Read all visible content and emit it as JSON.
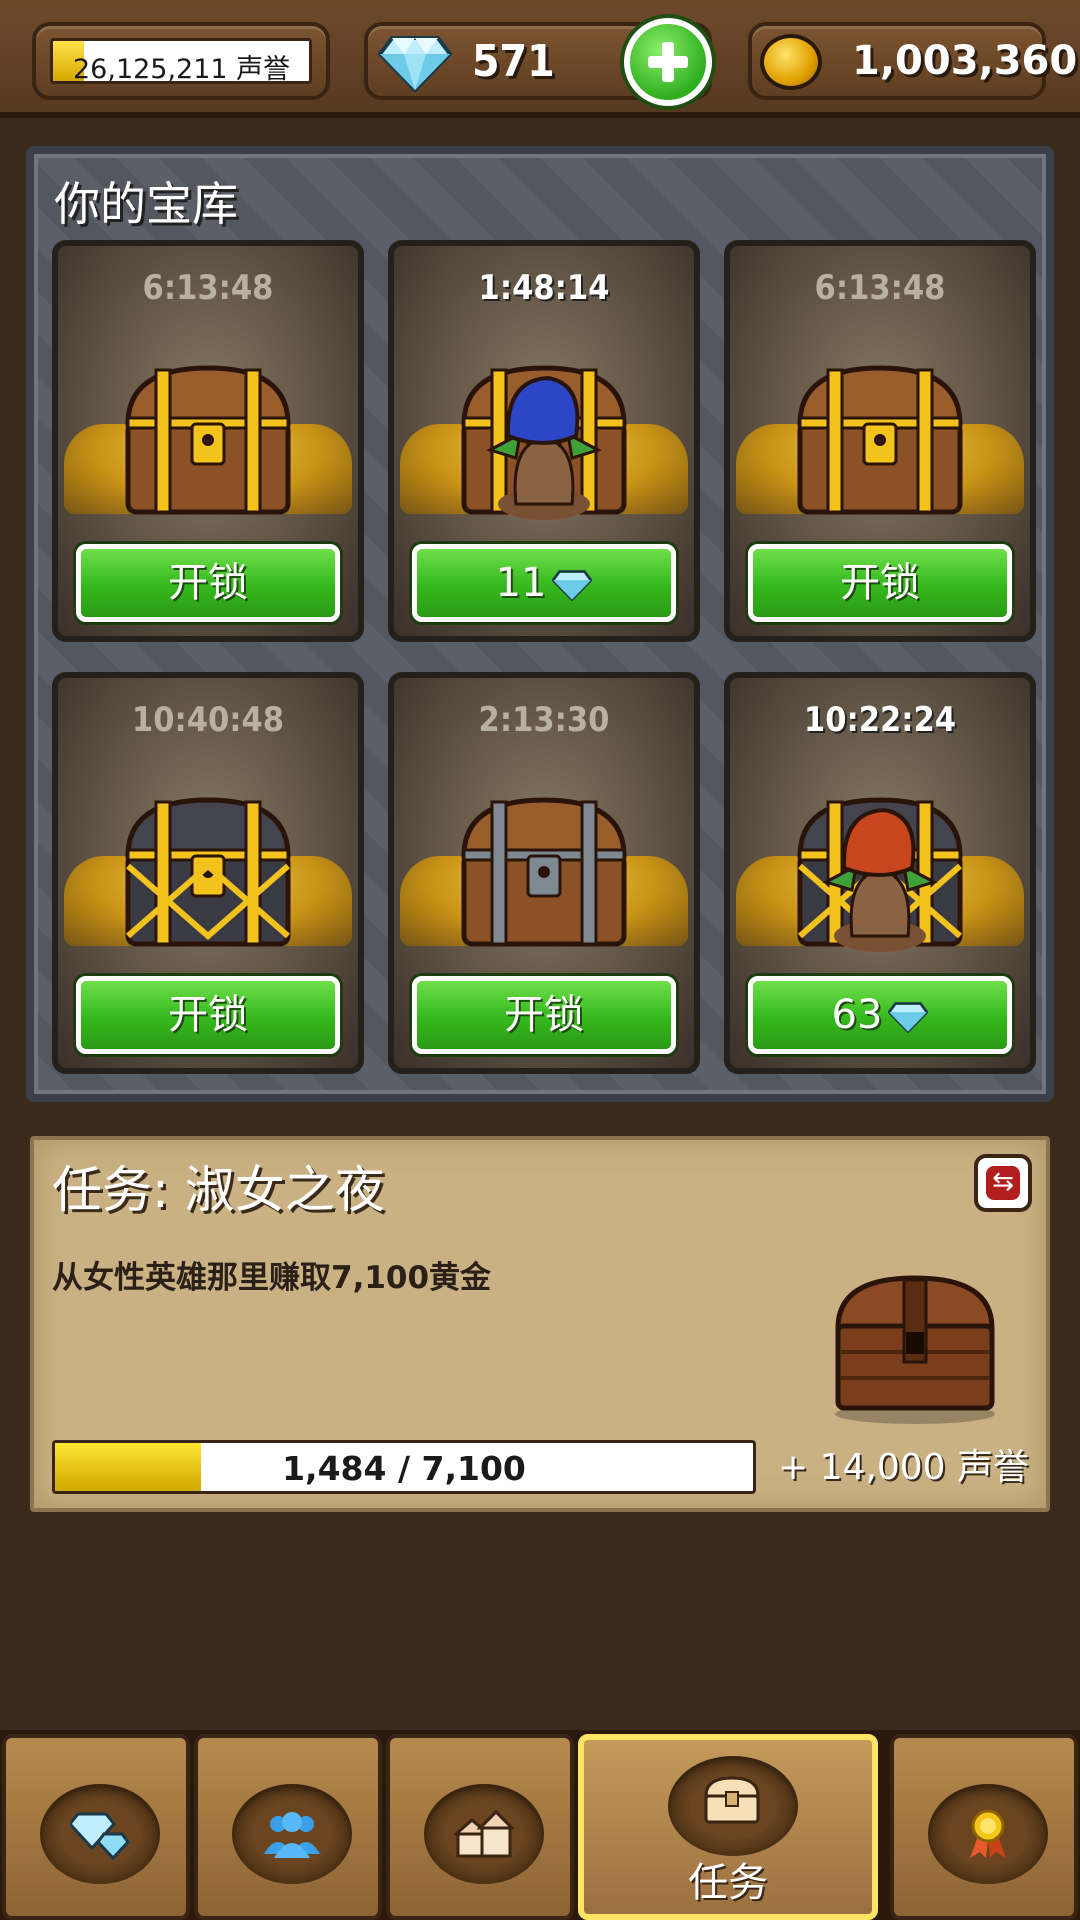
{
  "top_bar": {
    "reputation_text": "26,125,211 声誉",
    "reputation_progress": 0.12,
    "gems": "571",
    "gold": "1,003,360"
  },
  "vault": {
    "title": "你的宝库",
    "slots": [
      {
        "timer": "6:13:48",
        "timer_state": "idle",
        "chest": "gold-chest",
        "button": "开锁"
      },
      {
        "timer": "1:48:14",
        "timer_state": "active",
        "chest": "gold-chest-with-goblin-blue",
        "button": "11",
        "button_gem": true
      },
      {
        "timer": "6:13:48",
        "timer_state": "idle",
        "chest": "gold-chest",
        "button": "开锁"
      },
      {
        "timer": "10:40:48",
        "timer_state": "idle",
        "chest": "black-gold-chest",
        "button": "开锁"
      },
      {
        "timer": "2:13:30",
        "timer_state": "idle",
        "chest": "iron-chest",
        "button": "开锁"
      },
      {
        "timer": "10:22:24",
        "timer_state": "active",
        "chest": "black-gold-chest-with-goblin-red",
        "button": "63",
        "button_gem": true
      }
    ]
  },
  "quest": {
    "title": "任务: 淑女之夜",
    "description": "从女性英雄那里赚取7,100黄金",
    "progress_text": "1,484 / 7,100",
    "progress_value": 1484,
    "progress_max": 7100,
    "reward_text": "+ 14,000 声誉"
  },
  "bottom_nav": {
    "tabs": [
      {
        "icon": "gems-icon"
      },
      {
        "icon": "heroes-icon"
      },
      {
        "icon": "buildings-icon"
      },
      {
        "icon": "chest-icon",
        "label": "任务",
        "active": true
      },
      {
        "icon": "award-icon"
      }
    ]
  },
  "colors": {
    "button_green": "#35b81d",
    "progress_yellow": "#ffe733",
    "active_tab_border": "#ffe466"
  }
}
